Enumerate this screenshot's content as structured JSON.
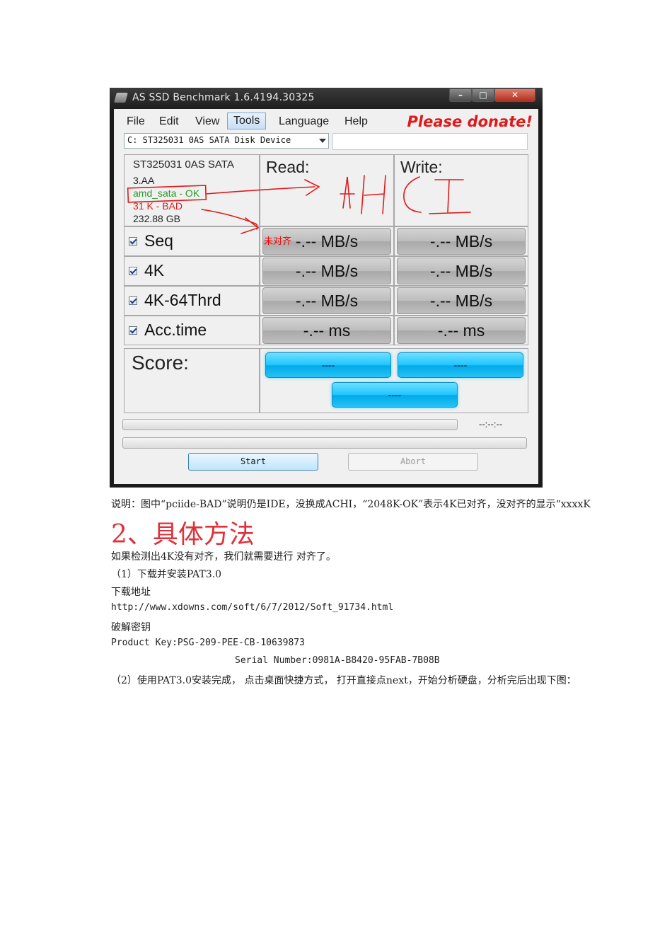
{
  "window": {
    "title": "AS SSD Benchmark 1.6.4194.30325",
    "menu": [
      "File",
      "Edit",
      "View",
      "Tools",
      "Language",
      "Help"
    ],
    "active_menu": "Tools",
    "donate": "Please donate!",
    "drive": "C: ST325031 0AS SATA Disk Device",
    "device_info": [
      "ST325031 0AS SATA",
      "3.AA",
      "amd_sata - OK",
      "31 K - BAD",
      "232.88 GB"
    ],
    "columns": {
      "read": "Read:",
      "write": "Write:"
    },
    "rows": [
      {
        "label": "Seq",
        "read": "-.-- MB/s",
        "write": "-.-- MB/s"
      },
      {
        "label": "4K",
        "read": "-.-- MB/s",
        "write": "-.-- MB/s"
      },
      {
        "label": "4K-64Thrd",
        "read": "-.-- MB/s",
        "write": "-.-- MB/s"
      },
      {
        "label": "Acc.time",
        "read": "-.-- ms",
        "write": "-.-- ms"
      }
    ],
    "score": {
      "label": "Score:",
      "read": "----",
      "write": "----",
      "total": "----"
    },
    "time": "--:--:--",
    "start": "Start",
    "abort": "Abort",
    "annotations": {
      "handwritten": "AHCI",
      "misaligned": "未对齐"
    }
  },
  "doc": {
    "caption": "说明：图中“pciide-BAD”说明仍是IDE，没换成ACHI，“2048K-OK”表示4K已对齐，没对齐的显示“xxxxK",
    "heading": "2、具体方法",
    "p1": "如果检测出4K没有对齐，我们就需要进行 对齐了。",
    "p2": "（1）下载并安装PAT3.0",
    "p3": "下载地址",
    "p4": "http://www.xdowns.com/soft/6/7/2012/Soft_91734.html",
    "p5": "破解密钥",
    "p6": "Product Key:PSG-209-PEE-CB-10639873",
    "p7": "Serial Number:0981A-B8420-95FAB-7B08B",
    "p8": "（2）使用PAT3.0安装完成， 点击桌面快捷方式， 打开直接点next，开始分析硬盘，分析完后出现下图："
  }
}
